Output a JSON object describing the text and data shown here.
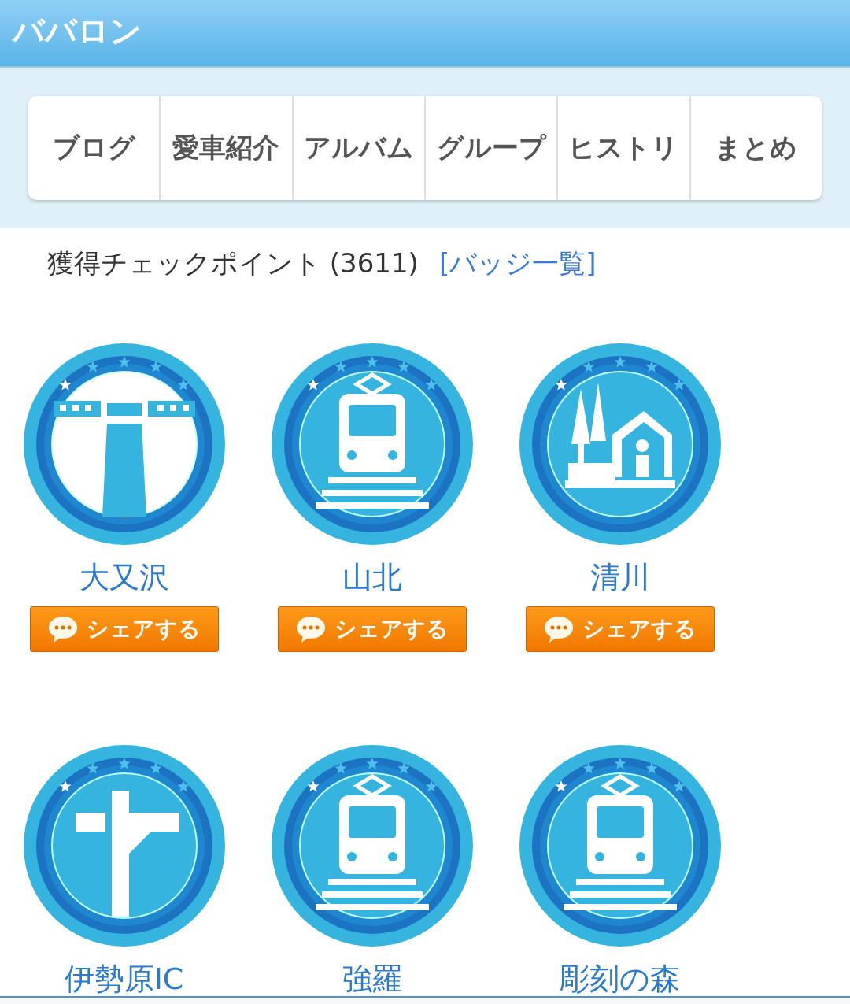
{
  "header": {
    "title": "ババロン"
  },
  "tabs": [
    {
      "label": "ブログ",
      "selected": false
    },
    {
      "label": "愛車紹介",
      "selected": false
    },
    {
      "label": "アルバム",
      "selected": false
    },
    {
      "label": "グループ",
      "selected": false
    },
    {
      "label": "ヒストリ",
      "selected": false
    },
    {
      "label": "まとめ",
      "selected": false
    }
  ],
  "section": {
    "title": "獲得チェックポイント (3611)",
    "link": "[バッジ一覧]"
  },
  "badges": [
    {
      "name": "大又沢",
      "kind": "dam",
      "share": "シェアする"
    },
    {
      "name": "山北",
      "kind": "train",
      "share": "シェアする"
    },
    {
      "name": "清川",
      "kind": "rest-area",
      "share": "シェアする"
    },
    {
      "name": "伊勢原IC",
      "kind": "interchange"
    },
    {
      "name": "強羅",
      "kind": "train"
    },
    {
      "name": "彫刻の森",
      "kind": "train"
    }
  ]
}
